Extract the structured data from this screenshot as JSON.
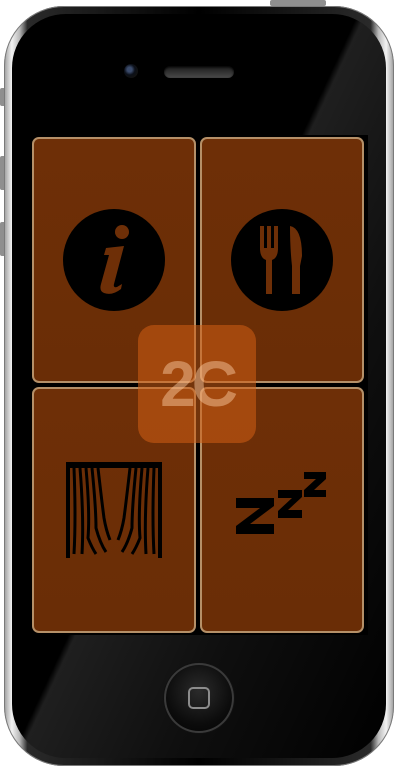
{
  "device": {
    "frame_color": "#000000",
    "tile_color": "#6e2f07",
    "tile_border_color": "#b59068"
  },
  "watermark": {
    "text": "2C"
  },
  "tiles": [
    {
      "id": "info",
      "icon": "info-icon"
    },
    {
      "id": "dining",
      "icon": "fork-knife-icon"
    },
    {
      "id": "theater",
      "icon": "curtains-icon"
    },
    {
      "id": "sleep",
      "icon": "zzz-icon"
    }
  ]
}
